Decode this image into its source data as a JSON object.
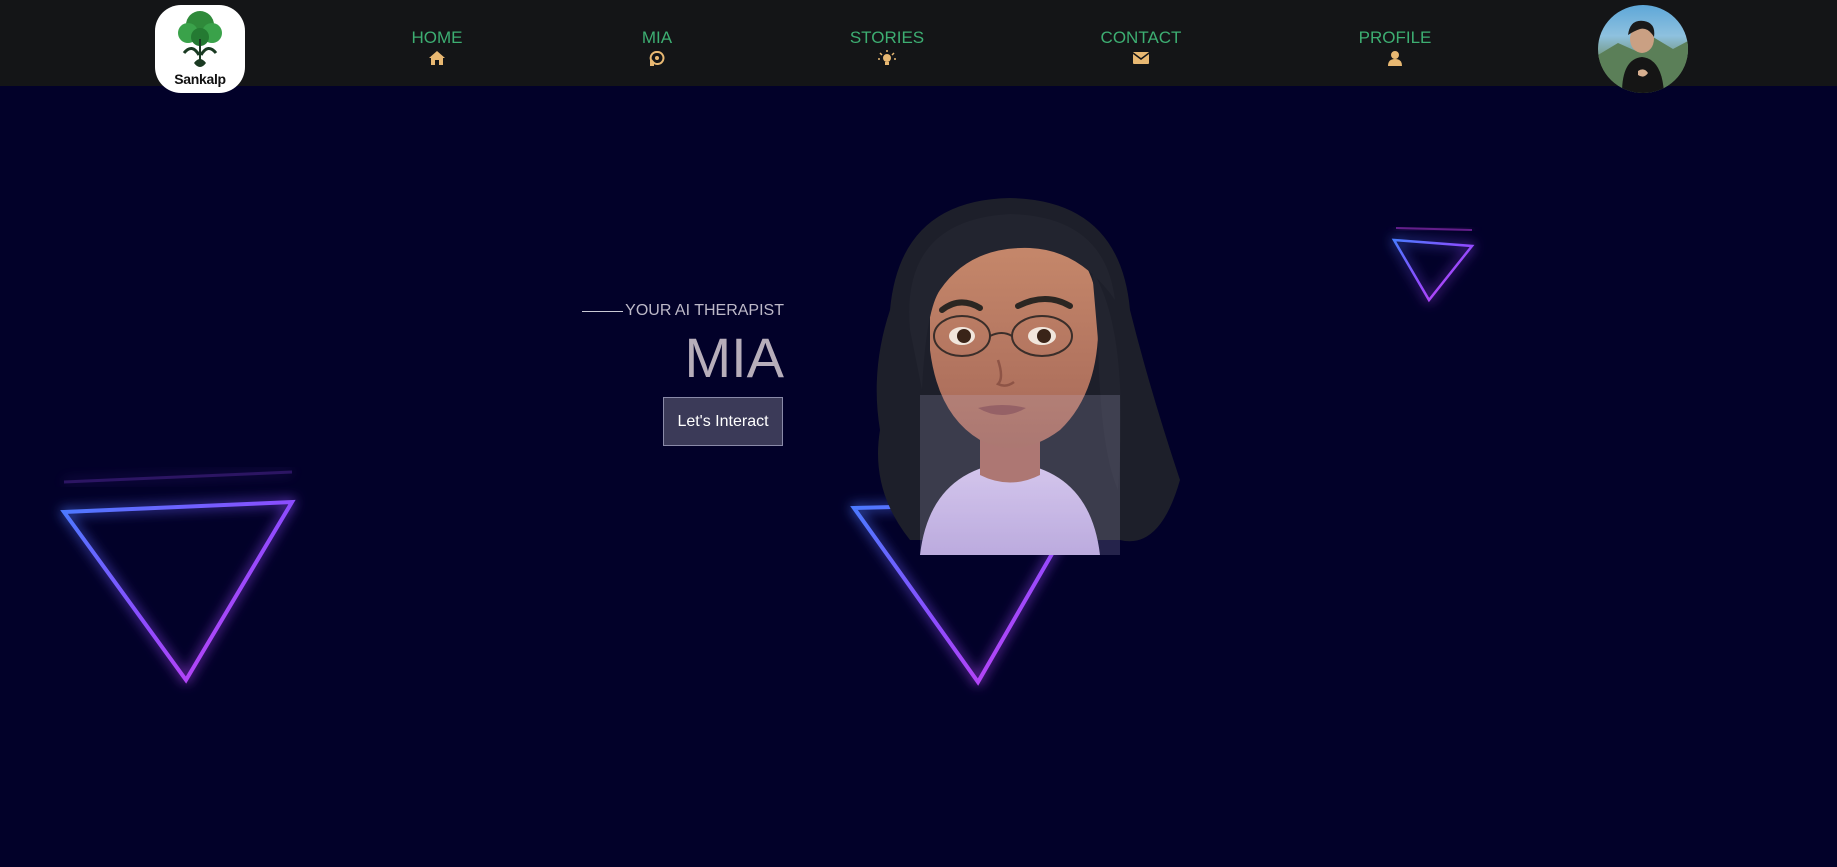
{
  "nav": {
    "logo_text": "Sankalp",
    "items": [
      {
        "label": "HOME",
        "icon": "home-icon"
      },
      {
        "label": "MIA",
        "icon": "brain-icon"
      },
      {
        "label": "STORIES",
        "icon": "lightbulb-icon"
      },
      {
        "label": "CONTACT",
        "icon": "envelope-icon"
      },
      {
        "label": "PROFILE",
        "icon": "user-icon"
      }
    ],
    "colors": {
      "background": "#141517",
      "label": "#3dae72",
      "icon": "#e8b872"
    }
  },
  "hero": {
    "tagline": "YOUR AI THERAPIST",
    "title": "MIA",
    "cta_label": "Let's Interact"
  },
  "colors": {
    "page_background": "#020129",
    "neon_pink": "#d13df0",
    "neon_blue": "#4a3ff5"
  }
}
